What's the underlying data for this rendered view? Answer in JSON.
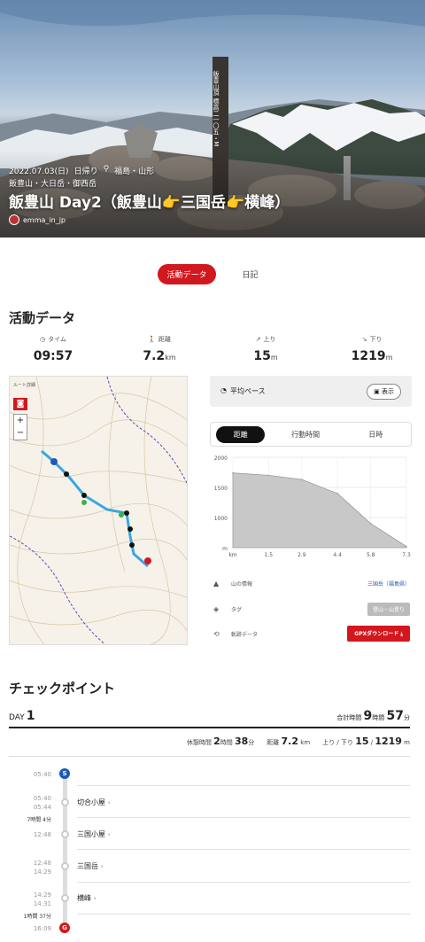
{
  "hero": {
    "date": "2022.07.03(日)",
    "duration_badge": "日帰り",
    "location": "福島・山形",
    "area": "飯豊山・大日岳・御西岳",
    "title": "飯豊山 Day2（飯豊山👉三国岳👉横峰）",
    "username": "emma_in_jp",
    "signpost_text": "飯豊山頂 標高二一〇五・M"
  },
  "tabs": [
    {
      "label": "活動データ",
      "active": true
    },
    {
      "label": "日記",
      "active": false
    }
  ],
  "activity": {
    "heading": "活動データ",
    "stats": [
      {
        "label": "タイム",
        "value": "09:57",
        "unit": "",
        "icon": "clock-icon"
      },
      {
        "label": "距離",
        "value": "7.2",
        "unit": "km",
        "icon": "hiker-icon"
      },
      {
        "label": "上り",
        "value": "15",
        "unit": "m",
        "icon": "arrow-up-right-icon"
      },
      {
        "label": "下り",
        "value": "1219",
        "unit": "m",
        "icon": "arrow-down-right-icon"
      }
    ]
  },
  "map": {
    "label": "ルート詳細",
    "zoom_in": "+",
    "zoom_out": "−"
  },
  "pace": {
    "label": "平均ペース",
    "button": "表示"
  },
  "segment": [
    "距離",
    "行動時間",
    "日時"
  ],
  "chart_data": {
    "type": "area",
    "x": [
      0,
      1.5,
      2.9,
      4.4,
      5.8,
      7.3
    ],
    "values": [
      1740,
      1700,
      1630,
      1400,
      900,
      520
    ],
    "xlabel": "km",
    "ylabel": "",
    "x_ticks": [
      "km",
      "1.5",
      "2.9",
      "4.4",
      "5.8",
      "7.3"
    ],
    "y_ticks": [
      "2000",
      "1500",
      "1000",
      "m"
    ],
    "ylim": [
      500,
      2000
    ],
    "fill_color": "#c8c8c8"
  },
  "info": {
    "mountain_label": "山の情報",
    "mountain_value": "三国岳（福島県）",
    "tag_label": "タグ",
    "tag_value": "登山・山登り",
    "track_label": "軌跡データ",
    "gpx_button": "GPXダウンロード"
  },
  "checkpoints": {
    "heading": "チェックポイント",
    "day_label": "DAY",
    "day_number": "1",
    "total_label": "合計時間",
    "total_hours": "9",
    "total_hours_unit": "時間",
    "total_minutes": "57",
    "total_minutes_unit": "分",
    "rest_label": "休憩時間",
    "rest_hours": "2",
    "rest_hours_unit": "時間",
    "rest_minutes": "38",
    "rest_minutes_unit": "分",
    "dist_label": "距離",
    "dist_value": "7.2",
    "dist_unit": "km",
    "updown_label": "上り / 下り",
    "up_value": "15",
    "down_value": "1219",
    "updown_unit": "m",
    "start_time": "05:40",
    "start_mark": "S",
    "goal_time": "16:09",
    "goal_mark": "G",
    "items": [
      {
        "times": [
          "05:40",
          "05:44"
        ],
        "name": "切合小屋"
      },
      {
        "times": [
          "12:48"
        ],
        "name": "三国小屋"
      },
      {
        "times": [
          "12:48",
          "14:29"
        ],
        "name": "三国岳"
      },
      {
        "times": [
          "14:29",
          "14:31"
        ],
        "name": "横峰"
      }
    ],
    "durations": [
      "7時間 4分",
      "1時間 37分"
    ]
  }
}
